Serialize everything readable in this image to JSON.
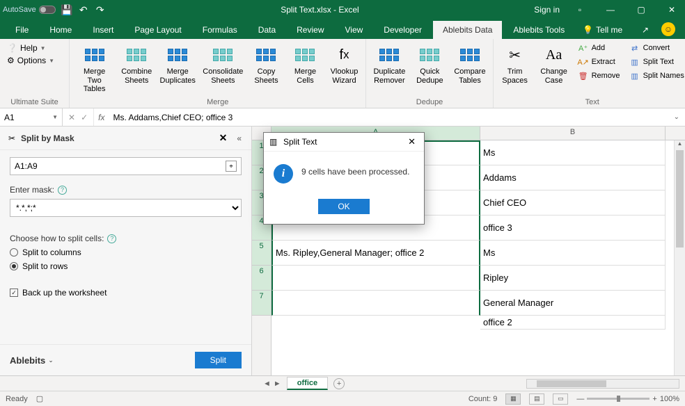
{
  "titlebar": {
    "autosave": "AutoSave",
    "title": "Split Text.xlsx - Excel",
    "signin": "Sign in"
  },
  "tabs": {
    "file": "File",
    "home": "Home",
    "insert": "Insert",
    "pagelayout": "Page Layout",
    "formulas": "Formulas",
    "data": "Data",
    "review": "Review",
    "view": "View",
    "developer": "Developer",
    "ablebits_data": "Ablebits Data",
    "ablebits_tools": "Ablebits Tools",
    "tellme": "Tell me"
  },
  "ribbon": {
    "help": "Help",
    "options": "Options",
    "suite": "Ultimate Suite",
    "merge_tables": "Merge\nTwo Tables",
    "combine_sheets": "Combine\nSheets",
    "merge_dup": "Merge\nDuplicates",
    "consolidate": "Consolidate\nSheets",
    "copy_sheets": "Copy\nSheets",
    "merge_cells": "Merge\nCells",
    "vlookup": "Vlookup\nWizard",
    "grp_merge": "Merge",
    "dup_remover": "Duplicate\nRemover",
    "quick_dedupe": "Quick\nDedupe",
    "compare_tables": "Compare\nTables",
    "grp_dedupe": "Dedupe",
    "trim_spaces": "Trim\nSpaces",
    "change_case": "Change\nCase",
    "add": "Add",
    "extract": "Extract",
    "remove": "Remove",
    "convert": "Convert",
    "split_text": "Split Text",
    "split_names": "Split Names",
    "grp_text": "Text"
  },
  "formula": {
    "name": "A1",
    "fx": "fx",
    "content": "Ms. Addams,Chief CEO; office  3"
  },
  "pane": {
    "title": "Split by Mask",
    "range": "A1:A9",
    "mask_label": "Enter mask:",
    "mask": "*.*,*;*",
    "choose_label": "Choose how to split cells:",
    "opt_cols": "Split to columns",
    "opt_rows": "Split to rows",
    "backup": "Back up the worksheet",
    "brand": "Ablebits",
    "split": "Split"
  },
  "grid": {
    "colA": "A",
    "colB": "B",
    "rowsA": [
      "",
      "",
      "",
      "",
      "Ms. Ripley,General Manager; office  2",
      "",
      ""
    ],
    "rowsB": [
      "Ms",
      "Addams",
      "Chief CEO",
      "office  3",
      "Ms",
      "Ripley",
      "General Manager",
      "office  2"
    ],
    "rowNums": [
      "1",
      "2",
      "3",
      "4",
      "5",
      "6",
      "7"
    ]
  },
  "sheets": {
    "tab1": "office",
    "add": "+"
  },
  "dialog": {
    "title": "Split Text",
    "message": "9 cells have been processed.",
    "ok": "OK"
  },
  "status": {
    "ready": "Ready",
    "count": "Count: 9",
    "zoom": "100%"
  }
}
